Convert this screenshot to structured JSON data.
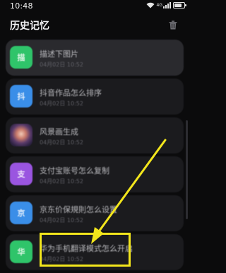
{
  "status_bar": {
    "time": "10:48",
    "wifi_icon": "wifi-icon",
    "signal_icon": "signal-icon",
    "network_label": "4G",
    "battery_icon": "battery-icon",
    "battery_level": 0.8
  },
  "header": {
    "title": "历史记忆",
    "trash_icon": "trash-icon"
  },
  "history": {
    "items": [
      {
        "icon_text": "描",
        "icon_color": "#2fc46a",
        "title": "描述下图片",
        "time": "04月02日 10:52"
      },
      {
        "icon_text": "抖",
        "icon_color": "#3a8ee8",
        "title": "抖音作品怎么排序",
        "time": "04月02日 10:52"
      },
      {
        "icon_text": "",
        "icon_color": "",
        "title": "风景画生成",
        "time": "04月02日 10:52"
      },
      {
        "icon_text": "支",
        "icon_color": "#9a55e0",
        "title": "支付宝账号怎么复制",
        "time": "04月02日 10:52"
      },
      {
        "icon_text": "京",
        "icon_color": "#3a8ee8",
        "title": "京东价保規則怎么设置",
        "time": "04月02日 10:52"
      },
      {
        "icon_text": "华",
        "icon_color": "#2fc46a",
        "title": "华为手机翻译模式怎么开启",
        "time": "04月02日 10:52"
      }
    ]
  },
  "annotation": {
    "arrow_color": "#f3e61c",
    "box_color": "#f3e61c"
  }
}
